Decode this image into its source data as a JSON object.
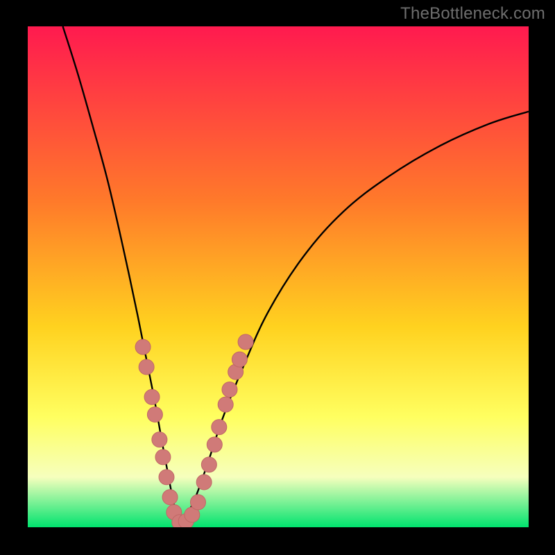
{
  "watermark": "TheBottleneck.com",
  "colors": {
    "frame": "#000000",
    "gradient_top": "#ff1a4f",
    "gradient_mid1": "#ff7a2a",
    "gradient_mid2": "#ffd21f",
    "gradient_mid3": "#ffff60",
    "gradient_mid4": "#f6ffbd",
    "gradient_bottom": "#00e36e",
    "curve": "#000000",
    "marker_fill": "#d07a78",
    "marker_stroke": "#c06866"
  },
  "chart_data": {
    "type": "line",
    "title": "",
    "xlabel": "",
    "ylabel": "",
    "xlim": [
      0,
      100
    ],
    "ylim": [
      0,
      100
    ],
    "curve": {
      "minimum_x": 30.3,
      "left": [
        {
          "x": 7.0,
          "y": 100.0
        },
        {
          "x": 10.0,
          "y": 90.5
        },
        {
          "x": 13.0,
          "y": 80.0
        },
        {
          "x": 16.0,
          "y": 69.0
        },
        {
          "x": 19.0,
          "y": 56.0
        },
        {
          "x": 22.0,
          "y": 42.0
        },
        {
          "x": 25.0,
          "y": 27.0
        },
        {
          "x": 27.0,
          "y": 16.0
        },
        {
          "x": 28.5,
          "y": 8.0
        },
        {
          "x": 29.5,
          "y": 3.0
        },
        {
          "x": 30.3,
          "y": 0.5
        }
      ],
      "right": [
        {
          "x": 30.3,
          "y": 0.5
        },
        {
          "x": 31.5,
          "y": 2.0
        },
        {
          "x": 33.5,
          "y": 6.0
        },
        {
          "x": 36.0,
          "y": 13.0
        },
        {
          "x": 39.0,
          "y": 22.0
        },
        {
          "x": 43.0,
          "y": 32.0
        },
        {
          "x": 48.0,
          "y": 43.0
        },
        {
          "x": 55.0,
          "y": 54.0
        },
        {
          "x": 63.0,
          "y": 63.0
        },
        {
          "x": 72.0,
          "y": 70.0
        },
        {
          "x": 82.0,
          "y": 76.0
        },
        {
          "x": 92.0,
          "y": 80.5
        },
        {
          "x": 100.0,
          "y": 83.0
        }
      ]
    },
    "markers": [
      {
        "x": 23.0,
        "y": 36.0
      },
      {
        "x": 23.7,
        "y": 32.0
      },
      {
        "x": 24.8,
        "y": 26.0
      },
      {
        "x": 25.4,
        "y": 22.5
      },
      {
        "x": 26.3,
        "y": 17.5
      },
      {
        "x": 27.0,
        "y": 14.0
      },
      {
        "x": 27.7,
        "y": 10.0
      },
      {
        "x": 28.4,
        "y": 6.0
      },
      {
        "x": 29.2,
        "y": 3.0
      },
      {
        "x": 30.3,
        "y": 1.0
      },
      {
        "x": 31.6,
        "y": 1.2
      },
      {
        "x": 32.8,
        "y": 2.5
      },
      {
        "x": 34.0,
        "y": 5.0
      },
      {
        "x": 35.2,
        "y": 9.0
      },
      {
        "x": 36.2,
        "y": 12.5
      },
      {
        "x": 37.3,
        "y": 16.5
      },
      {
        "x": 38.2,
        "y": 20.0
      },
      {
        "x": 39.5,
        "y": 24.5
      },
      {
        "x": 40.3,
        "y": 27.5
      },
      {
        "x": 41.5,
        "y": 31.0
      },
      {
        "x": 42.3,
        "y": 33.5
      },
      {
        "x": 43.5,
        "y": 37.0
      }
    ]
  }
}
